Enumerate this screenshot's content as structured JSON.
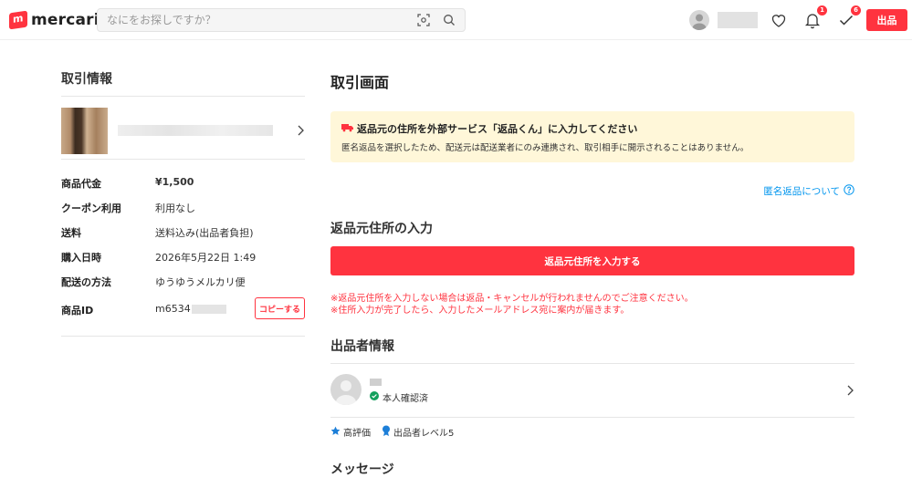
{
  "header": {
    "logo_text": "mercari",
    "search_placeholder": "なにをお探しですか？",
    "notification_count": "1",
    "todo_count": "6",
    "sell_label": "出品"
  },
  "left": {
    "title": "取引情報",
    "info": [
      {
        "label": "商品代金",
        "value": "¥1,500"
      },
      {
        "label": "クーポン利用",
        "value": "利用なし"
      },
      {
        "label": "送料",
        "value": "送料込み(出品者負担)"
      },
      {
        "label": "購入日時",
        "value": "2026年5月22日 1:49"
      },
      {
        "label": "配送の方法",
        "value": "ゆうゆうメルカリ便"
      },
      {
        "label": "商品ID",
        "value": "m6534"
      }
    ],
    "copy_label": "コピーする"
  },
  "main": {
    "title": "取引画面",
    "notice_head": "返品元の住所を外部サービス「返品くん」に入力してください",
    "notice_body": "匿名返品を選択したため、配送元は配送業者にのみ連携され、取引相手に開示されることはありません。",
    "anon_link": "匿名返品について",
    "address_section": "返品元住所の入力",
    "address_button": "返品元住所を入力する",
    "warn1": "※返品元住所を入力しない場合は返品・キャンセルが行われませんのでご注意ください。",
    "warn2": "※住所入力が完了したら、入力したメールアドレス宛に案内が届きます。",
    "seller_section": "出品者情報",
    "verified": "本人確認済",
    "tag_rating": "高評価",
    "tag_level": "出品者レベル5",
    "message_section": "メッセージ"
  },
  "colors": {
    "brand": "#ff333f",
    "notice_bg": "#fff7d9",
    "link": "#0095ee",
    "verified": "#12a05c"
  }
}
